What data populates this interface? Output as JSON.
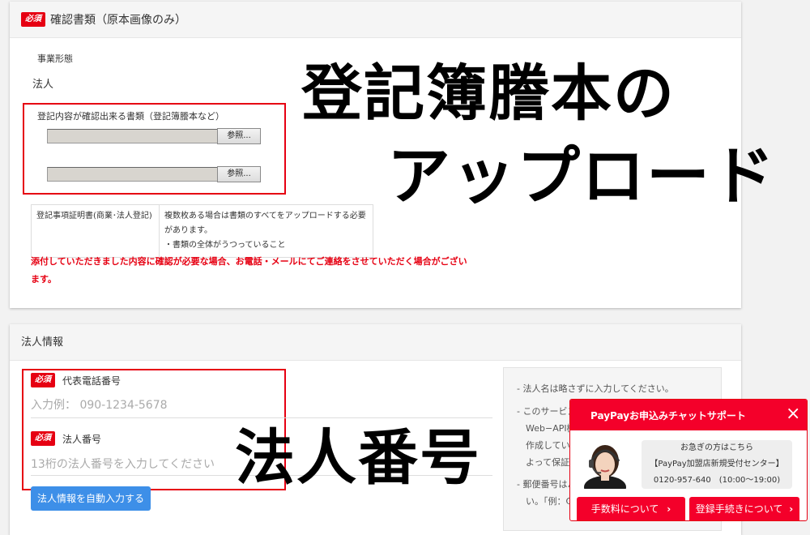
{
  "card1": {
    "badge": "必須",
    "title": "確認書類（原本画像のみ）",
    "business_type_label": "事業形態",
    "business_type_value": "法人",
    "upload_label": "登記内容が確認出来る書類（登記簿謄本など）",
    "browse_button": "参照...",
    "table": [
      {
        "doc": "登記事項証明書(商業･法人登記)",
        "notes": [
          "複数枚ある場合は書類のすべてをアップロードする必要があります。",
          "・書類の全体がうつっていること"
        ]
      }
    ],
    "notice": "添付していただきました内容に確認が必要な場合、お電話・メールにてご連絡をさせていただく場合がございます。"
  },
  "overlay": {
    "line1": "登記簿謄本の",
    "line2": "アップロード",
    "line3": "法人番号"
  },
  "card2": {
    "title": "法人情報",
    "badge": "必須",
    "phone_label": "代表電話番号",
    "phone_placeholder": "入力例： 090-1234-5678",
    "corp_number_label": "法人番号",
    "corp_number_placeholder": "13桁の法人番号を入力してください",
    "autofill_button": "法人情報を自動入力する",
    "hints": [
      "- 法人名は略さずに入力してください。",
      "- このサービス",
      "Web−API機",
      "作成していま",
      "よって保証さ",
      "- 郵便番号はハ",
      "い。「例：C"
    ]
  },
  "chat": {
    "title": "PayPayお申込みチャットサポート",
    "close": "×",
    "urgent": "お急ぎの方はこちら",
    "center": "【PayPay加盟店新規受付センター】",
    "phone": "0120-957-640　(10:00〜19:00)",
    "buttons": [
      "手数料について",
      "登録手続きについて"
    ]
  },
  "colors": {
    "accent_red": "#e60012",
    "chat_red": "#f4002a",
    "button_blue": "#3d8fe8"
  }
}
